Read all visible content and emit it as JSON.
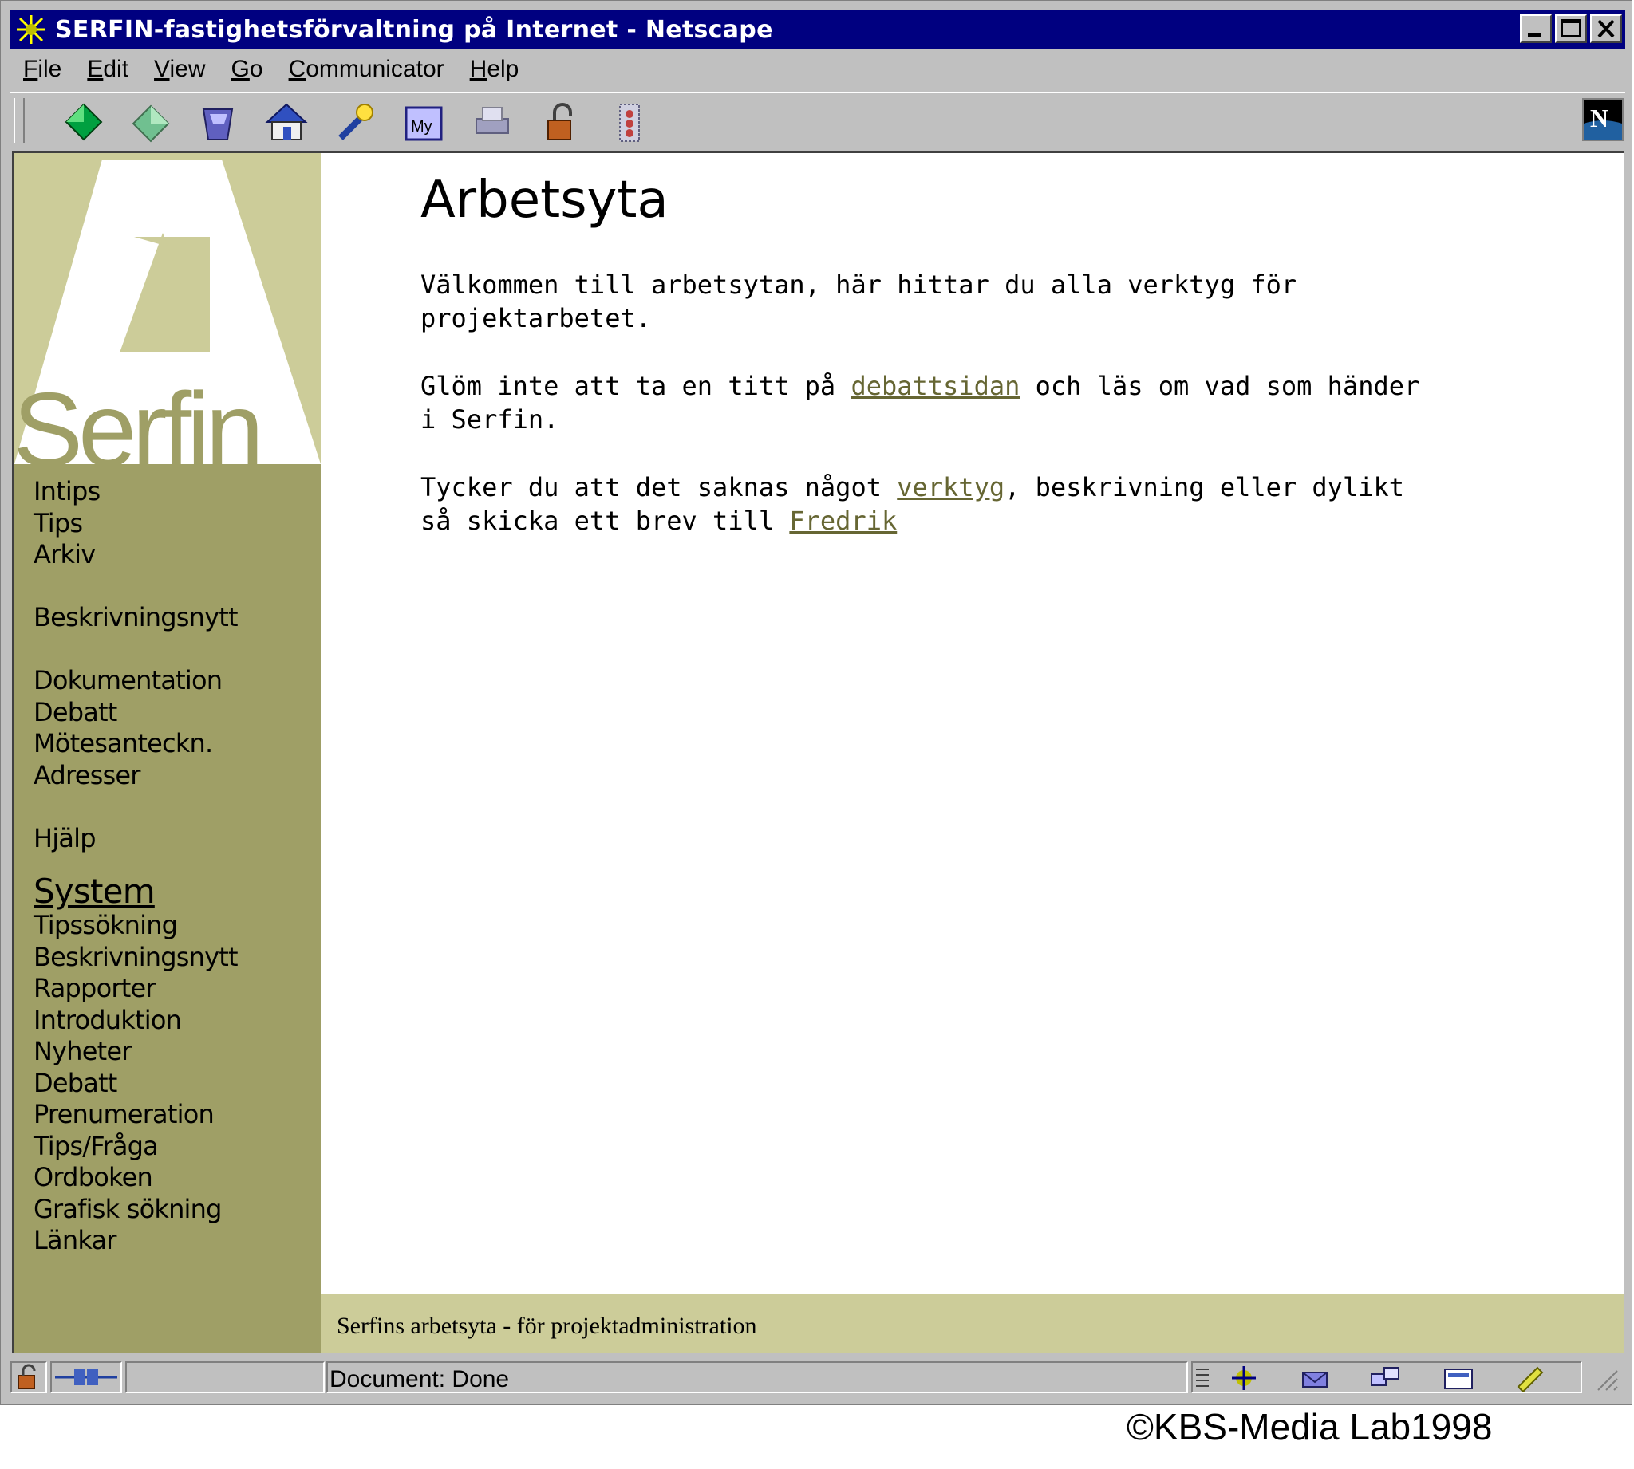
{
  "window": {
    "title": "SERFIN-fastighetsförvaltning på Internet - Netscape"
  },
  "menubar": {
    "items": [
      {
        "ul": "F",
        "rest": "ile"
      },
      {
        "ul": "E",
        "rest": "dit"
      },
      {
        "ul": "V",
        "rest": "iew"
      },
      {
        "ul": "G",
        "rest": "o"
      },
      {
        "ul": "C",
        "rest": "ommunicator"
      },
      {
        "ul": "H",
        "rest": "elp"
      }
    ]
  },
  "toolbar": {
    "icons": [
      "back-icon",
      "forward-icon",
      "reload-icon",
      "home-icon",
      "search-icon",
      "my-netscape-icon",
      "print-icon",
      "security-icon",
      "stop-icon"
    ]
  },
  "sidebar": {
    "logo": {
      "letter": "A",
      "word": "Serfin"
    },
    "groups": [
      [
        "Intips",
        "Tips",
        "Arkiv"
      ],
      [
        "Beskrivningsnytt"
      ],
      [
        "Dokumentation",
        "Debatt",
        "Mötesanteckn.",
        "Adresser"
      ],
      [
        "Hjälp"
      ]
    ],
    "system_label": "System",
    "system_items": [
      "Tipssökning",
      "Beskrivningsnytt",
      "Rapporter",
      "Introduktion",
      "Nyheter",
      "Debatt",
      "Prenumeration",
      "Tips/Fråga",
      "Ordboken",
      "Grafisk sökning",
      "Länkar"
    ]
  },
  "main": {
    "title": "Arbetsyta",
    "p1": "Välkommen till arbetsytan, här hittar du alla verktyg för projektarbetet.",
    "p2_before": "Glöm inte att ta en titt på ",
    "p2_link": "debattsidan",
    "p2_after": " och läs om vad som händer i Serfin.",
    "p3_before": "Tycker du att det saknas något ",
    "p3_link1": "verktyg",
    "p3_middle": ", beskrivning eller dylikt så skicka ett brev till ",
    "p3_link2": "Fredrik"
  },
  "footer": {
    "text": "Serfins arbetsyta - för projektadministration"
  },
  "statusbar": {
    "text": "Document: Done"
  },
  "copyright": "©KBS-Media Lab1998",
  "colors": {
    "titlebar": "#000080",
    "sidebar": "#9f9f66",
    "footer": "#cccc99",
    "link": "#666633"
  }
}
